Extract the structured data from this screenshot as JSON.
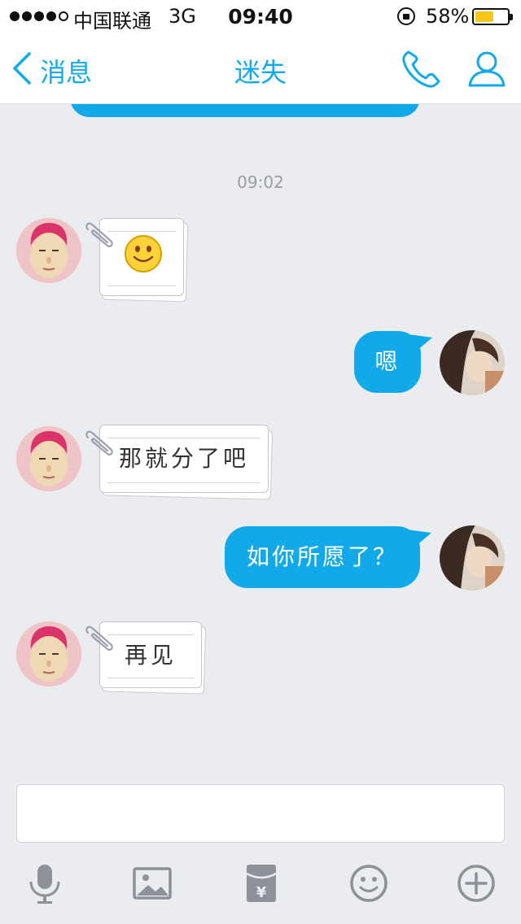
{
  "status_bar": {
    "carrier": "中国联通",
    "network": "3G",
    "time": "09:40",
    "battery_percent": "58%",
    "battery_level": 0.58,
    "signal_bars_filled": 4,
    "signal_bars_total": 5
  },
  "nav": {
    "back_label": "消息",
    "title": "迷失"
  },
  "chat": {
    "timestamp": "09:02",
    "messages": [
      {
        "side": "left",
        "kind": "sticker-note",
        "content": "smile-emoji"
      },
      {
        "side": "right",
        "kind": "bubble",
        "text": "嗯"
      },
      {
        "side": "left",
        "kind": "note",
        "text": "那就分了吧"
      },
      {
        "side": "right",
        "kind": "bubble",
        "text": "如你所愿了？"
      },
      {
        "side": "left",
        "kind": "note",
        "text": "再见"
      }
    ]
  },
  "toolbar": {
    "items": [
      "microphone-icon",
      "image-icon",
      "red-packet-icon",
      "emoji-icon",
      "plus-icon"
    ]
  },
  "colors": {
    "accent": "#12a9ea",
    "background": "#ebecf0",
    "battery": "#f5c518",
    "toolbar_icon": "#8e909a"
  }
}
